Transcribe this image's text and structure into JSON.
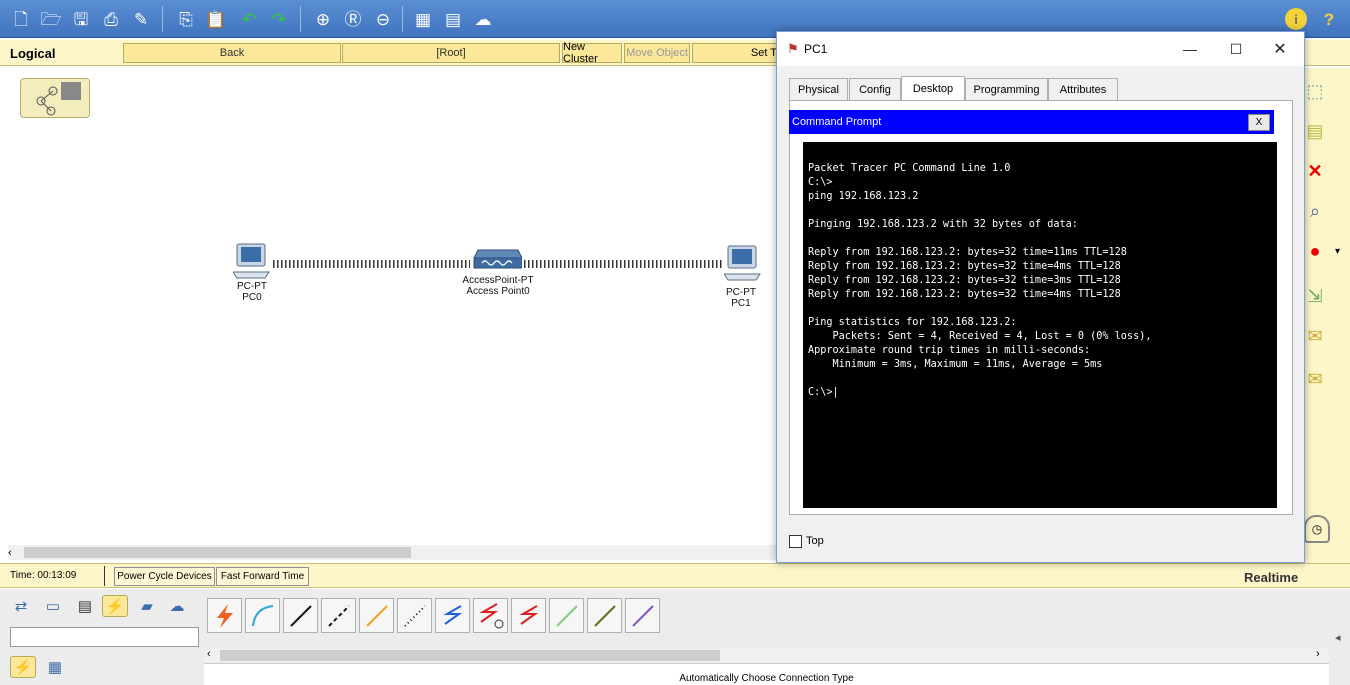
{
  "toolbar": {
    "icons": [
      "new-file-icon",
      "open-folder-icon",
      "save-icon",
      "print-icon",
      "activity-wizard-icon",
      "copy-icon",
      "paste-icon",
      "undo-icon",
      "redo-icon",
      "zoom-in-icon",
      "zoom-reset-icon",
      "zoom-out-icon",
      "palette-icon",
      "custom-device-icon",
      "cloud-icon",
      "info-icon",
      "help-icon"
    ]
  },
  "logical_bar": {
    "title": "Logical",
    "back": "Back",
    "root": "[Root]",
    "new_cluster": "New Cluster",
    "move_object": "Move Object",
    "set_tiled": "Set Ti"
  },
  "devices": [
    {
      "type": "PC-PT",
      "name": "PC0"
    },
    {
      "type": "AccessPoint-PT",
      "name": "Access Point0"
    },
    {
      "type": "PC-PT",
      "name": "PC1"
    }
  ],
  "status": {
    "time": "Time: 00:13:09",
    "power_cycle": "Power Cycle Devices",
    "fast_forward": "Fast Forward Time",
    "mode": "Realtime"
  },
  "bottom": {
    "connection_label": "Automatically Choose Connection Type",
    "search_value": ""
  },
  "pc_window": {
    "title": "PC1",
    "tabs": [
      "Physical",
      "Config",
      "Desktop",
      "Programming",
      "Attributes"
    ],
    "active_tab": "Desktop",
    "cmd_title": "Command Prompt",
    "cmd_close": "X",
    "top_checkbox_label": "Top",
    "top_checked": false,
    "terminal_lines": [
      "Packet Tracer PC Command Line 1.0",
      "C:\\>",
      "ping 192.168.123.2",
      "",
      "Pinging 192.168.123.2 with 32 bytes of data:",
      "",
      "Reply from 192.168.123.2: bytes=32 time=11ms TTL=128",
      "Reply from 192.168.123.2: bytes=32 time=4ms TTL=128",
      "Reply from 192.168.123.2: bytes=32 time=3ms TTL=128",
      "Reply from 192.168.123.2: bytes=32 time=4ms TTL=128",
      "",
      "Ping statistics for 192.168.123.2:",
      "    Packets: Sent = 4, Received = 4, Lost = 0 (0% loss),",
      "Approximate round trip times in milli-seconds:",
      "    Minimum = 3ms, Maximum = 11ms, Average = 5ms",
      "",
      "C:\\>|"
    ]
  },
  "colors": {
    "toolbar": "#4a7fc8",
    "logical_bar": "#fdf6c9",
    "cmd_titlebar": "#0000ff",
    "terminal_bg": "#000000"
  }
}
